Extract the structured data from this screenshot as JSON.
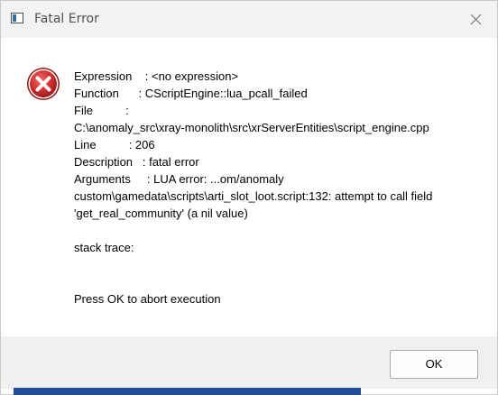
{
  "window": {
    "title": "Fatal Error"
  },
  "message": {
    "lines": [
      "Expression    : <no expression>",
      "Function      : CScriptEngine::lua_pcall_failed",
      "File          :",
      "C:\\anomaly_src\\xray-monolith\\src\\xrServerEntities\\script_engine.cpp",
      "Line          : 206",
      "Description   : fatal error",
      "Arguments     : LUA error: ...om/anomaly",
      "custom\\gamedata\\scripts\\arti_slot_loot.script:132: attempt to call field",
      "'get_real_community' (a nil value)",
      "",
      "stack trace:",
      "",
      "",
      "Press OK to abort execution"
    ]
  },
  "buttons": {
    "ok_label": "OK"
  },
  "icons": {
    "app": "window-app-icon",
    "close": "close-icon",
    "error": "error-icon"
  },
  "colors": {
    "error_red": "#d32f2f",
    "footer_bg": "#f0f0f0",
    "taskbar_accent": "#1f4e9c"
  }
}
